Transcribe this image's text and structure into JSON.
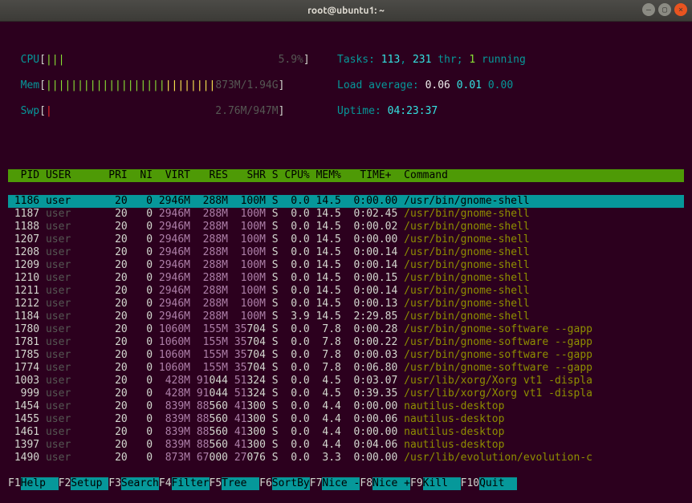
{
  "window": {
    "title": "root@ubuntu1: ~"
  },
  "meters": {
    "cpu": {
      "label": "CPU",
      "bar": "|||",
      "value": "5.9%"
    },
    "mem": {
      "label": "Mem",
      "bar_used": "|||||||||||||||||||",
      "bar_cache": "||||||||",
      "value": "873M/1.94G"
    },
    "swp": {
      "label": "Swp",
      "bar": "|",
      "value": "2.76M/947M"
    }
  },
  "info": {
    "tasks_label": "Tasks:",
    "tasks": "113",
    "tasks_sep": ", ",
    "threads": "231",
    "thr_label": " thr; ",
    "running": "1",
    "running_label": " running",
    "load_label": "Load average: ",
    "load1": "0.06",
    "load2": "0.01",
    "load3": "0.00",
    "uptime_label": "Uptime: ",
    "uptime": "04:23:37"
  },
  "headers": {
    "pid": "  PID",
    "user": "USER",
    "pri": "PRI",
    "ni": " NI",
    "virt": " VIRT",
    "res": "  RES",
    "shr": "  SHR",
    "s": "S",
    "cpu": "CPU%",
    "mem": "MEM%",
    "time": "  TIME+ ",
    "cmd": "Command"
  },
  "rows": [
    {
      "pid": "1186",
      "user": "user",
      "pri": "20",
      "ni": "0",
      "virt": "2946M",
      "res": "288M",
      "shr": "100M",
      "s": "S",
      "cpu": "0.0",
      "mem": "14.5",
      "time": "0:00.00",
      "cmd": "/usr/bin/gnome-shell",
      "sel": true
    },
    {
      "pid": "1187",
      "user": "user",
      "pri": "20",
      "ni": "0",
      "virt": "2946M",
      "res": "288M",
      "shr": "100M",
      "s": "S",
      "cpu": "0.0",
      "mem": "14.5",
      "time": "0:02.45",
      "cmd": "/usr/bin/gnome-shell"
    },
    {
      "pid": "1188",
      "user": "user",
      "pri": "20",
      "ni": "0",
      "virt": "2946M",
      "res": "288M",
      "shr": "100M",
      "s": "S",
      "cpu": "0.0",
      "mem": "14.5",
      "time": "0:00.02",
      "cmd": "/usr/bin/gnome-shell"
    },
    {
      "pid": "1207",
      "user": "user",
      "pri": "20",
      "ni": "0",
      "virt": "2946M",
      "res": "288M",
      "shr": "100M",
      "s": "S",
      "cpu": "0.0",
      "mem": "14.5",
      "time": "0:00.00",
      "cmd": "/usr/bin/gnome-shell"
    },
    {
      "pid": "1208",
      "user": "user",
      "pri": "20",
      "ni": "0",
      "virt": "2946M",
      "res": "288M",
      "shr": "100M",
      "s": "S",
      "cpu": "0.0",
      "mem": "14.5",
      "time": "0:00.14",
      "cmd": "/usr/bin/gnome-shell"
    },
    {
      "pid": "1209",
      "user": "user",
      "pri": "20",
      "ni": "0",
      "virt": "2946M",
      "res": "288M",
      "shr": "100M",
      "s": "S",
      "cpu": "0.0",
      "mem": "14.5",
      "time": "0:00.14",
      "cmd": "/usr/bin/gnome-shell"
    },
    {
      "pid": "1210",
      "user": "user",
      "pri": "20",
      "ni": "0",
      "virt": "2946M",
      "res": "288M",
      "shr": "100M",
      "s": "S",
      "cpu": "0.0",
      "mem": "14.5",
      "time": "0:00.15",
      "cmd": "/usr/bin/gnome-shell"
    },
    {
      "pid": "1211",
      "user": "user",
      "pri": "20",
      "ni": "0",
      "virt": "2946M",
      "res": "288M",
      "shr": "100M",
      "s": "S",
      "cpu": "0.0",
      "mem": "14.5",
      "time": "0:00.14",
      "cmd": "/usr/bin/gnome-shell"
    },
    {
      "pid": "1212",
      "user": "user",
      "pri": "20",
      "ni": "0",
      "virt": "2946M",
      "res": "288M",
      "shr": "100M",
      "s": "S",
      "cpu": "0.0",
      "mem": "14.5",
      "time": "0:00.13",
      "cmd": "/usr/bin/gnome-shell"
    },
    {
      "pid": "1184",
      "user": "user",
      "pri": "20",
      "ni": "0",
      "virt": "2946M",
      "res": "288M",
      "shr": "100M",
      "s": "S",
      "cpu": "3.9",
      "mem": "14.5",
      "time": "2:29.85",
      "cmd": "/usr/bin/gnome-shell"
    },
    {
      "pid": "1780",
      "user": "user",
      "pri": "20",
      "ni": "0",
      "virt": "1060M",
      "res": "155M",
      "shr_hi": "35",
      "shr": "704",
      "s": "S",
      "cpu": "0.0",
      "mem": "7.8",
      "time": "0:00.28",
      "cmd": "/usr/bin/gnome-software --gapp"
    },
    {
      "pid": "1781",
      "user": "user",
      "pri": "20",
      "ni": "0",
      "virt": "1060M",
      "res": "155M",
      "shr_hi": "35",
      "shr": "704",
      "s": "S",
      "cpu": "0.0",
      "mem": "7.8",
      "time": "0:00.22",
      "cmd": "/usr/bin/gnome-software --gapp"
    },
    {
      "pid": "1785",
      "user": "user",
      "pri": "20",
      "ni": "0",
      "virt": "1060M",
      "res": "155M",
      "shr_hi": "35",
      "shr": "704",
      "s": "S",
      "cpu": "0.0",
      "mem": "7.8",
      "time": "0:00.03",
      "cmd": "/usr/bin/gnome-software --gapp"
    },
    {
      "pid": "1774",
      "user": "user",
      "pri": "20",
      "ni": "0",
      "virt": "1060M",
      "res": "155M",
      "shr_hi": "35",
      "shr": "704",
      "s": "S",
      "cpu": "0.0",
      "mem": "7.8",
      "time": "0:06.80",
      "cmd": "/usr/bin/gnome-software --gapp"
    },
    {
      "pid": "1003",
      "user": "user",
      "pri": "20",
      "ni": "0",
      "virt": " 428M",
      "res_hi": "91",
      "res": "044",
      "shr_hi": "51",
      "shr": "324",
      "s": "S",
      "cpu": "0.0",
      "mem": "4.5",
      "time": "0:03.07",
      "cmd": "/usr/lib/xorg/Xorg vt1 -displa"
    },
    {
      "pid": " 999",
      "user": "user",
      "pri": "20",
      "ni": "0",
      "virt": " 428M",
      "res_hi": "91",
      "res": "044",
      "shr_hi": "51",
      "shr": "324",
      "s": "S",
      "cpu": "0.0",
      "mem": "4.5",
      "time": "0:39.35",
      "cmd": "/usr/lib/xorg/Xorg vt1 -displa"
    },
    {
      "pid": "1454",
      "user": "user",
      "pri": "20",
      "ni": "0",
      "virt": " 839M",
      "res_hi": "88",
      "res": "560",
      "shr_hi": "41",
      "shr": "300",
      "s": "S",
      "cpu": "0.0",
      "mem": "4.4",
      "time": "0:00.00",
      "cmd": "nautilus-desktop"
    },
    {
      "pid": "1455",
      "user": "user",
      "pri": "20",
      "ni": "0",
      "virt": " 839M",
      "res_hi": "88",
      "res": "560",
      "shr_hi": "41",
      "shr": "300",
      "s": "S",
      "cpu": "0.0",
      "mem": "4.4",
      "time": "0:00.06",
      "cmd": "nautilus-desktop"
    },
    {
      "pid": "1461",
      "user": "user",
      "pri": "20",
      "ni": "0",
      "virt": " 839M",
      "res_hi": "88",
      "res": "560",
      "shr_hi": "41",
      "shr": "300",
      "s": "S",
      "cpu": "0.0",
      "mem": "4.4",
      "time": "0:00.00",
      "cmd": "nautilus-desktop"
    },
    {
      "pid": "1397",
      "user": "user",
      "pri": "20",
      "ni": "0",
      "virt": " 839M",
      "res_hi": "88",
      "res": "560",
      "shr_hi": "41",
      "shr": "300",
      "s": "S",
      "cpu": "0.0",
      "mem": "4.4",
      "time": "0:04.06",
      "cmd": "nautilus-desktop"
    },
    {
      "pid": "1490",
      "user": "user",
      "pri": "20",
      "ni": "0",
      "virt": " 873M",
      "res_hi": "67",
      "res": "000",
      "shr_hi": "27",
      "shr": "076",
      "s": "S",
      "cpu": "0.0",
      "mem": "3.3",
      "time": "0:00.00",
      "cmd": "/usr/lib/evolution/evolution-c"
    }
  ],
  "fn": [
    {
      "key": "F1",
      "label": "Help  "
    },
    {
      "key": "F2",
      "label": "Setup "
    },
    {
      "key": "F3",
      "label": "Search"
    },
    {
      "key": "F4",
      "label": "Filter"
    },
    {
      "key": "F5",
      "label": "Tree  "
    },
    {
      "key": "F6",
      "label": "SortBy"
    },
    {
      "key": "F7",
      "label": "Nice -"
    },
    {
      "key": "F8",
      "label": "Nice +"
    },
    {
      "key": "F9",
      "label": "Kill  "
    },
    {
      "key": "F10",
      "label": "Quit  "
    }
  ]
}
